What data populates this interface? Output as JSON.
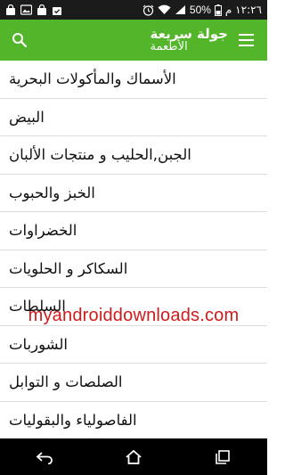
{
  "status_bar": {
    "time": "١٢:٢٦ م",
    "battery_percent": "50%",
    "icons": [
      "shopping-bag-icon",
      "photo-icon",
      "bag-icon",
      "check-bag-icon",
      "clock-alarm-icon",
      "wifi-icon",
      "signal-icon",
      "battery-icon"
    ]
  },
  "app_bar": {
    "title": "جولة سريعة",
    "subtitle": "الأطعمة",
    "background_color": "#52b52a"
  },
  "list": {
    "items": [
      {
        "label": "الأسماك والمأكولات البحرية"
      },
      {
        "label": "البيض"
      },
      {
        "label": "الجبن,الحليب و منتجات الألبان"
      },
      {
        "label": "الخبز والحبوب"
      },
      {
        "label": "الخضراوات"
      },
      {
        "label": "السكاكر و الحلويات"
      },
      {
        "label": "السلطات"
      },
      {
        "label": "الشوربات"
      },
      {
        "label": "الصلصات و التوابل"
      },
      {
        "label": "الفاصولياء والبقوليات"
      }
    ]
  },
  "watermark": {
    "text": "myandroiddownloads.com",
    "color": "#d11b1b"
  },
  "nav_bar": {
    "buttons": [
      "back-icon",
      "home-icon",
      "recent-apps-icon"
    ]
  }
}
